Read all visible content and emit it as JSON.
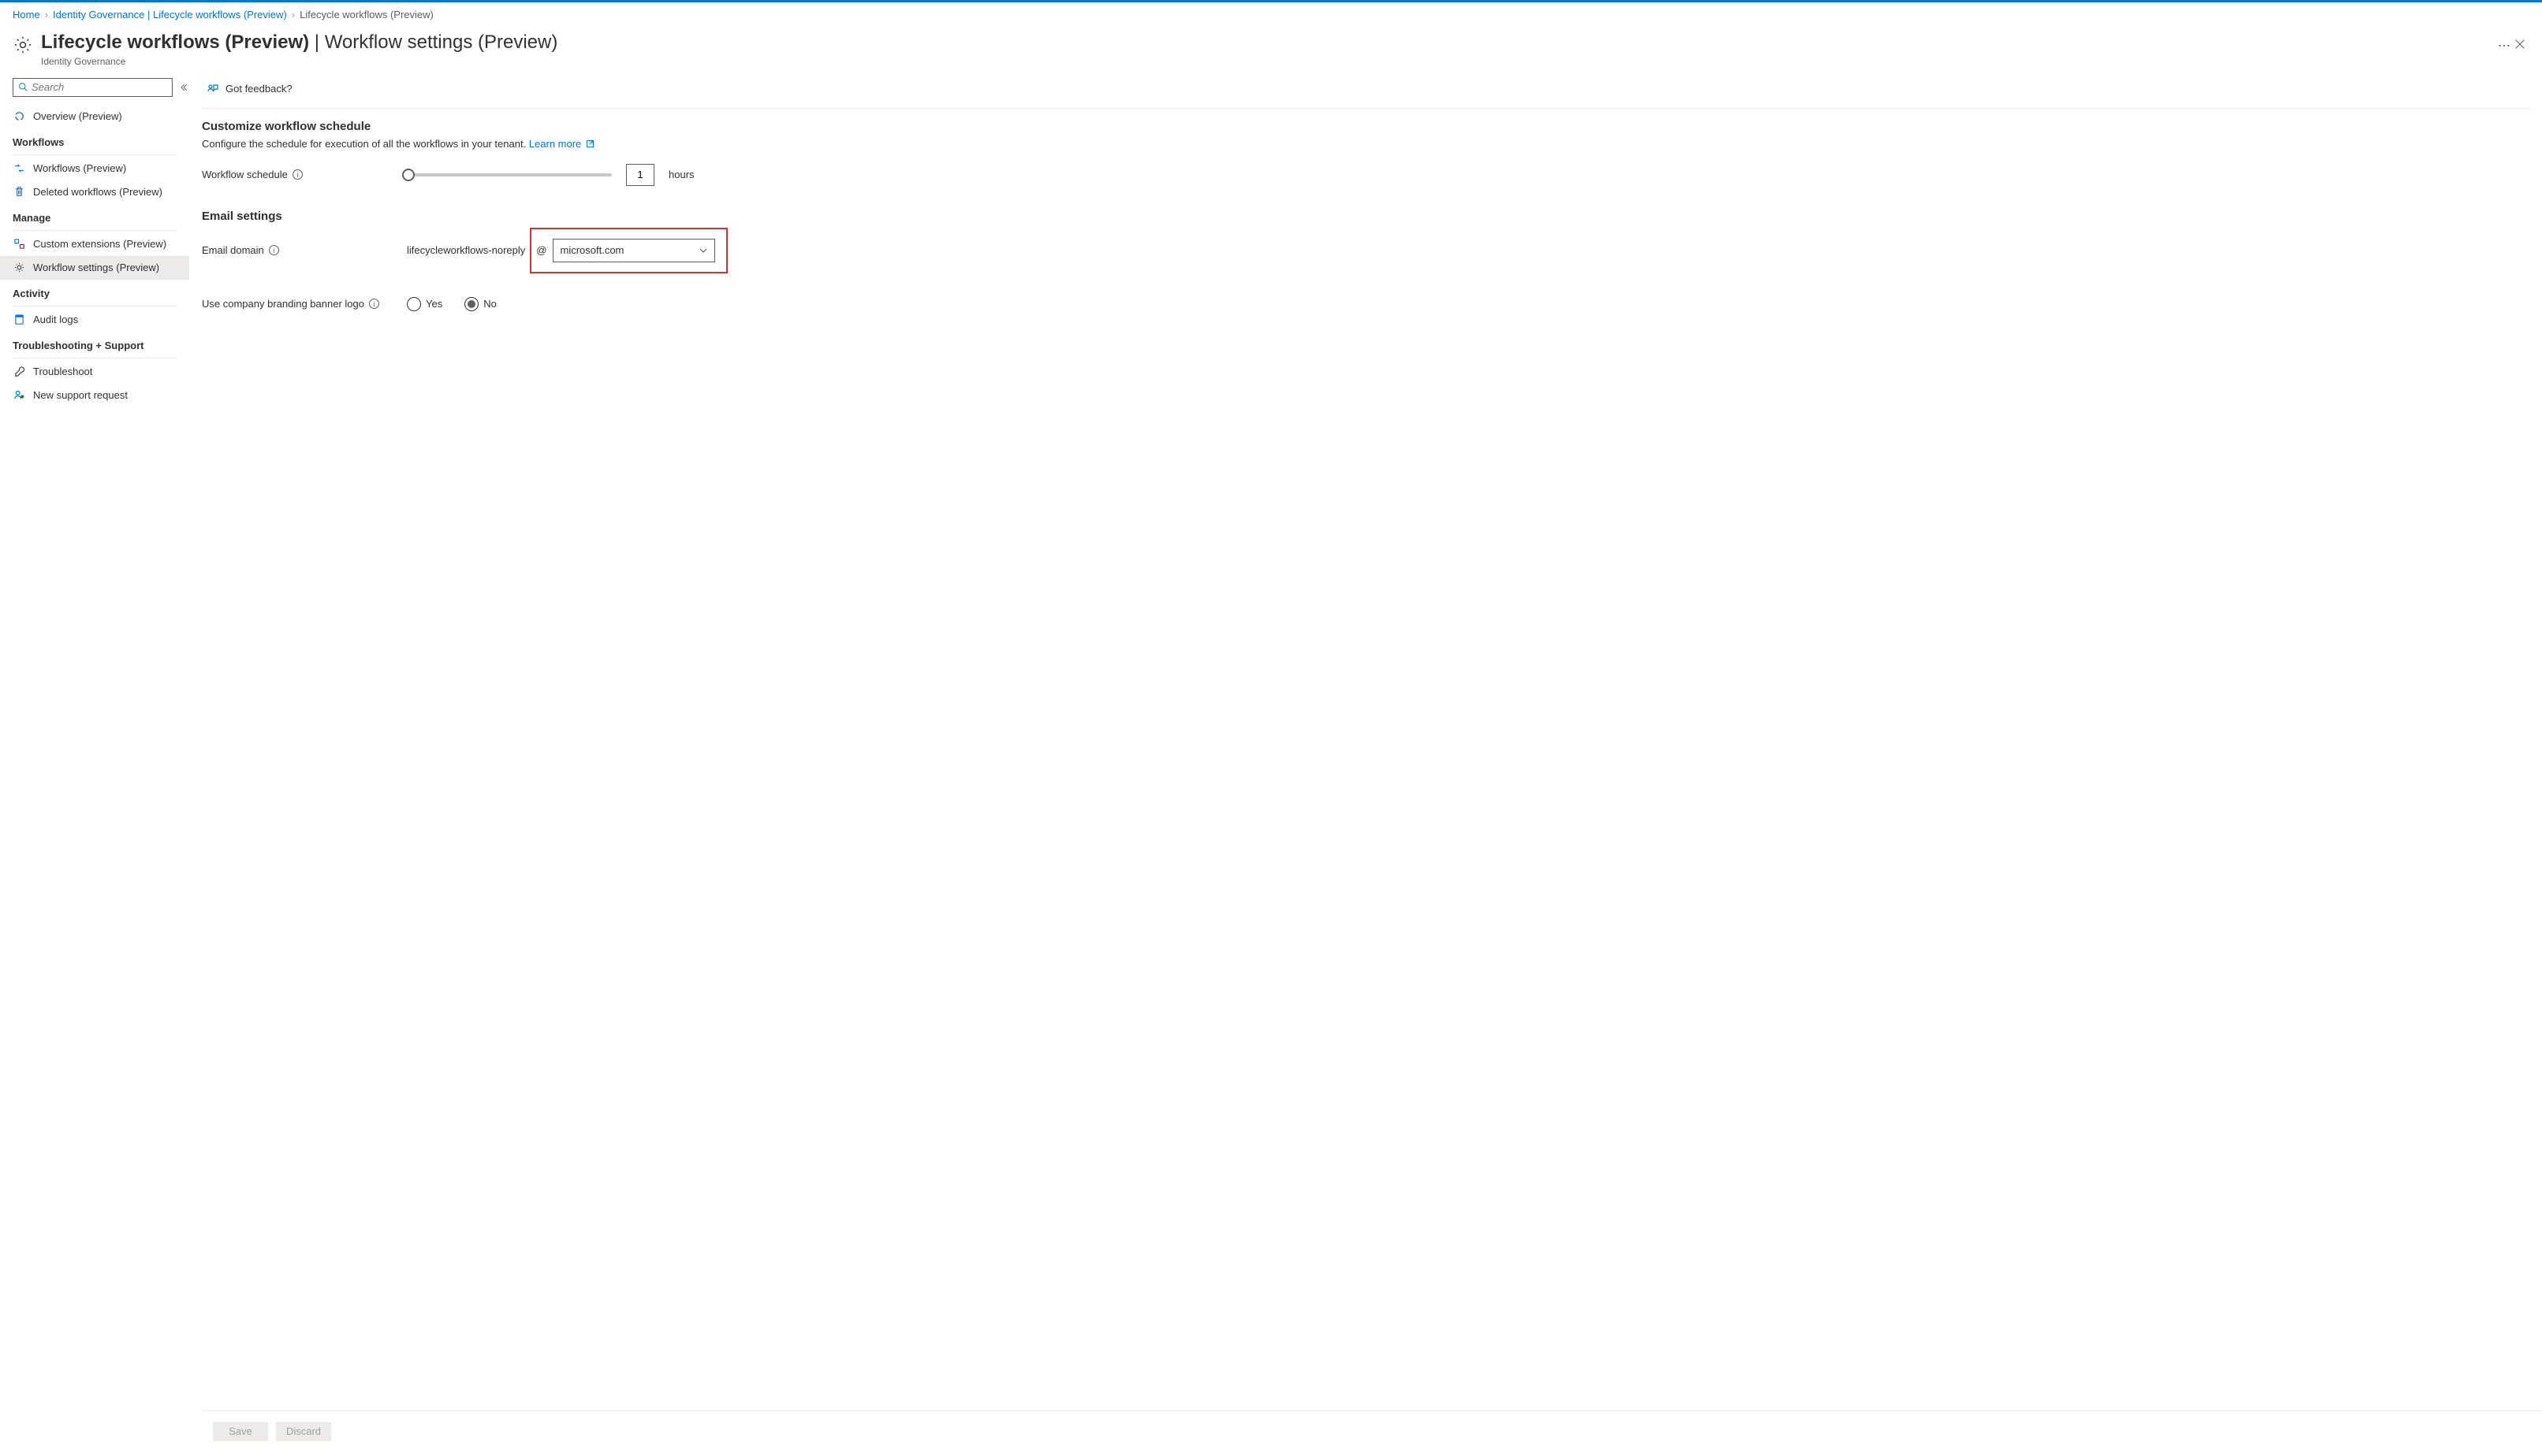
{
  "breadcrumb": {
    "items": [
      "Home",
      "Identity Governance | Lifecycle workflows (Preview)",
      "Lifecycle workflows (Preview)"
    ]
  },
  "header": {
    "title_main": "Lifecycle workflows (Preview)",
    "title_sub": "Workflow settings (Preview)",
    "subtitle": "Identity Governance"
  },
  "sidebar": {
    "search_placeholder": "Search",
    "overview_label": "Overview (Preview)",
    "section_workflows": "Workflows",
    "workflows_item": "Workflows (Preview)",
    "deleted_item": "Deleted workflows (Preview)",
    "section_manage": "Manage",
    "custom_ext_item": "Custom extensions (Preview)",
    "settings_item": "Workflow settings (Preview)",
    "section_activity": "Activity",
    "audit_item": "Audit logs",
    "section_trouble": "Troubleshooting + Support",
    "troubleshoot_item": "Troubleshoot",
    "support_item": "New support request"
  },
  "command": {
    "feedback": "Got feedback?"
  },
  "schedule": {
    "title": "Customize workflow schedule",
    "sub": "Configure the schedule for execution of all the workflows in your tenant. ",
    "learn_more": "Learn more",
    "label": "Workflow schedule",
    "value": "1",
    "unit": "hours"
  },
  "email": {
    "title": "Email settings",
    "domain_label": "Email domain",
    "prefix": "lifecycleworkflows-noreply",
    "at": "@",
    "domain_value": "microsoft.com",
    "branding_label": "Use company branding banner logo",
    "yes": "Yes",
    "no": "No"
  },
  "footer": {
    "save": "Save",
    "discard": "Discard"
  }
}
